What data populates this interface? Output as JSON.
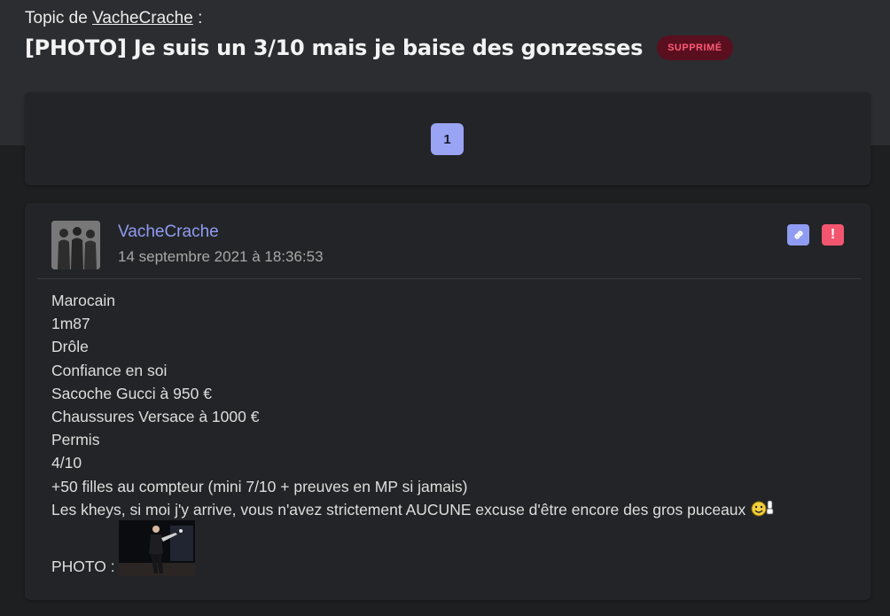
{
  "header": {
    "topic_prefix": "Topic de",
    "topic_author": "VacheCrache",
    "topic_suffix": ":",
    "title": "[PHOTO] Je suis un 3/10 mais je baise des gonzesses",
    "badge": "SUPPRIMÉ"
  },
  "pagination": {
    "pages": [
      "1"
    ]
  },
  "post": {
    "author": "VacheCrache",
    "date": "14 septembre 2021 à 18:36:53",
    "lines": [
      "Marocain",
      "1m87",
      "Drôle",
      "Confiance en soi",
      "Sacoche Gucci à 950 €",
      "Chaussures Versace à 1000 €",
      "Permis",
      "4/10",
      "+50 filles au compteur (mini 7/10 + preuves en MP si jamais)",
      "Les kheys, si moi j'y arrive, vous n'avez strictement AUCUNE excuse d'être encore des gros puceaux"
    ],
    "photo_label": "PHOTO :"
  },
  "icons": {
    "link": "link-icon",
    "report": "exclamation-icon",
    "smiley": "smiley-thumbsup-icon"
  },
  "colors": {
    "accent": "#9aa4f5",
    "author": "#8f9cf2",
    "danger": "#f2566f",
    "badge_bg": "#5a0f1f",
    "badge_text": "#ff5b76"
  }
}
